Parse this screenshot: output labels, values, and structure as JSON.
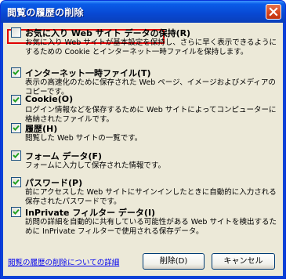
{
  "window": {
    "title": "閲覧の履歴の削除"
  },
  "items": [
    {
      "label": "お気に入り Web サイト データの保持(R)",
      "checked": false,
      "description": "お気に入り Web サイトが基本設定を保持し、さらに早く表示できるようにするための Cookie とインターネット一時ファイルを保持します。"
    },
    {
      "label": "インターネット一時ファイル(T)",
      "checked": true,
      "description": "表示の高速化のために保存された Web ページ、イメージおよびメディアのコピーです。"
    },
    {
      "label": "Cookie(O)",
      "checked": true,
      "description": "ログイン情報などを保存するために Web サイトによってコンピューターに格納されたファイルです。"
    },
    {
      "label": "履歴(H)",
      "checked": true,
      "description": "閲覧した Web サイトの一覧です。"
    },
    {
      "label": "フォーム データ(F)",
      "checked": true,
      "description": "フォームに入力して保存された情報です。"
    },
    {
      "label": "パスワード(P)",
      "checked": true,
      "description": "前にアクセスした Web サイトにサインインしたときに自動的に入力される保存されたパスワードです。"
    },
    {
      "label": "InPrivate フィルター データ(I)",
      "checked": true,
      "description": "訪問の詳細を自動的に共有している可能性がある Web サイトを検出するために InPrivate フィルターで使用される保存データ。"
    }
  ],
  "footer": {
    "link": "閲覧の履歴の削除についての詳細",
    "delete_button": "削除(D)",
    "cancel_button": "キャンセル"
  }
}
